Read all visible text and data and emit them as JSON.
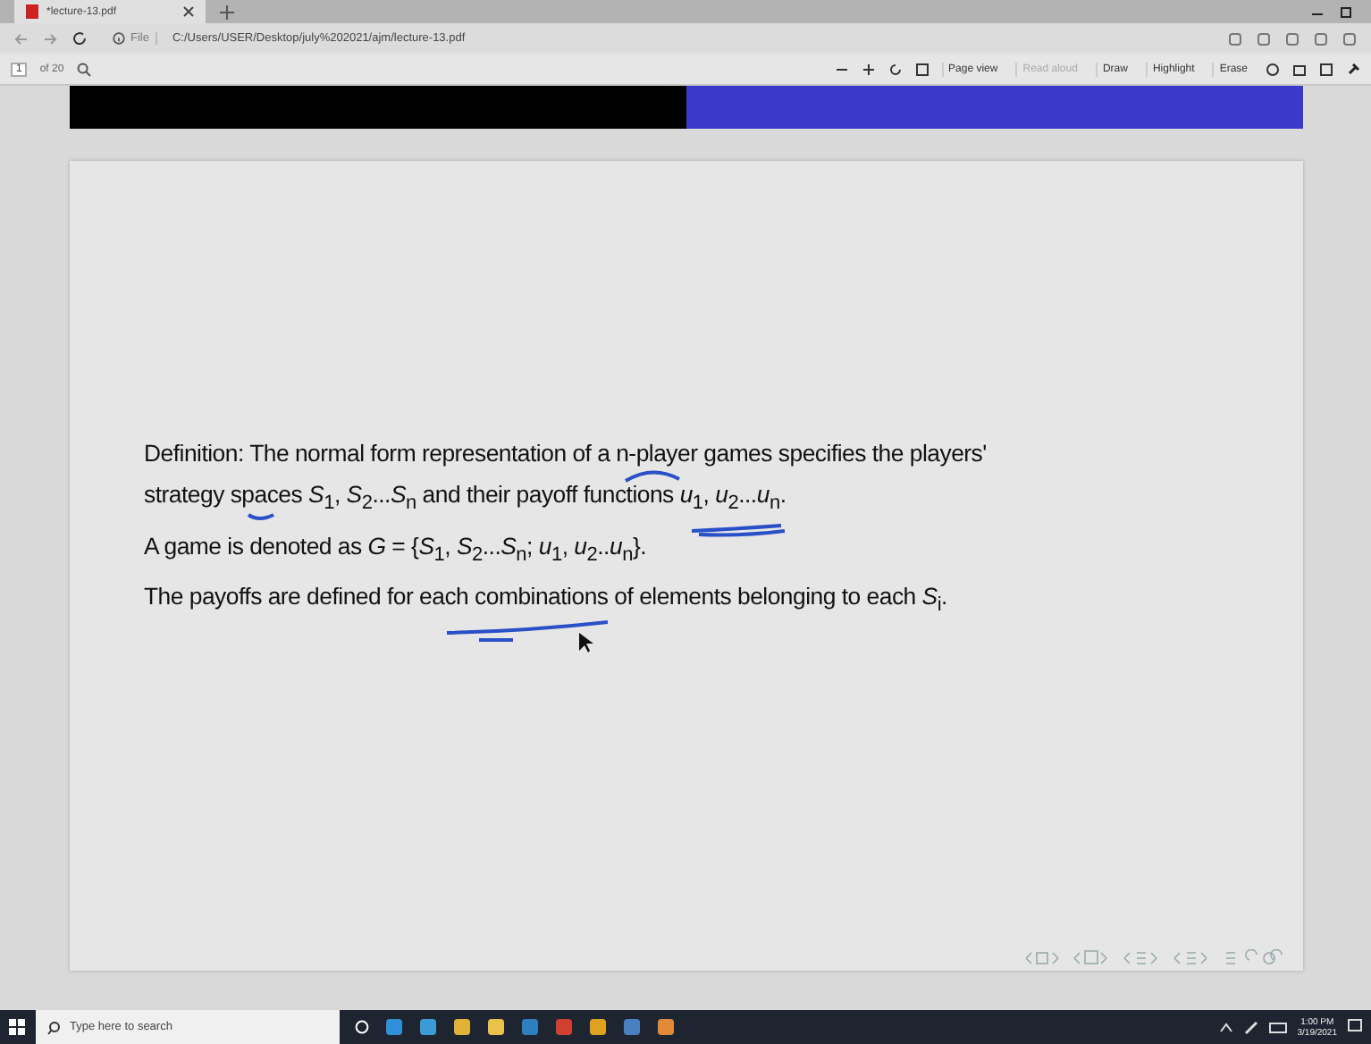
{
  "browser": {
    "tabs": [
      {
        "title": "*lecture-13.pdf",
        "selected": true
      }
    ],
    "address": {
      "scheme": "File",
      "url": "C:/Users/USER/Desktop/july%202021/ajm/lecture-13.pdf"
    }
  },
  "pdf_toolbar": {
    "page_number": "1",
    "page_count": "of 20",
    "tools": [
      {
        "label": "Page view",
        "disabled": false
      },
      {
        "label": "Read aloud",
        "disabled": true
      },
      {
        "label": "Draw",
        "disabled": false
      },
      {
        "label": "Highlight",
        "disabled": false
      },
      {
        "label": "Erase",
        "disabled": false
      }
    ]
  },
  "slide": {
    "lines": [
      "Definition: The normal form representation of a n-player games specifies the players'",
      "strategy spaces *S*$_{1}$, *S*$_{2}$...*S*$_{n}$ and their payoff functions *u*$_{1}$, *u*$_{2}$...*u*$_{n}$.",
      "A game is denoted as *G* = {*S*$_{1}$, *S*$_{2}$...*S*$_{n}$; *u*$_{1}$, *u*$_{2}$..*u*$_{n}$}.",
      "The payoffs are defined for each combinations of elements belonging to each *S*$_{i}$."
    ]
  },
  "taskbar": {
    "search_placeholder": "Type here to search",
    "time": "1:00 PM",
    "date": "3/19/2021"
  }
}
